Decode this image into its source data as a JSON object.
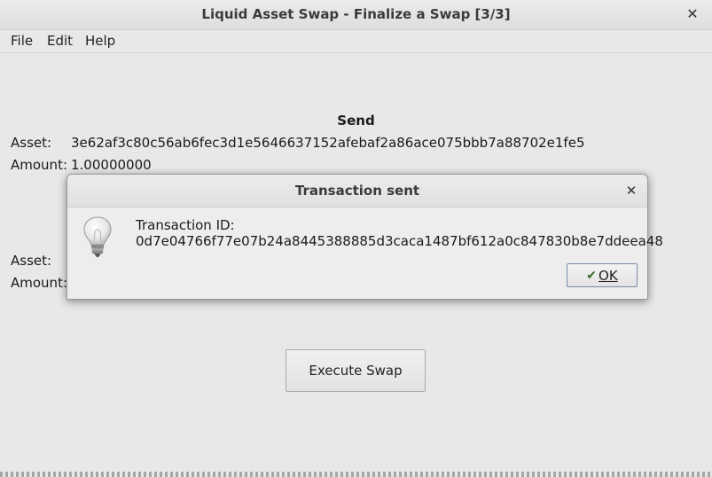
{
  "window": {
    "title": "Liquid Asset Swap - Finalize a Swap [3/3]",
    "close_glyph": "✕"
  },
  "menu": {
    "file": "File",
    "edit": "Edit",
    "help": "Help"
  },
  "send": {
    "heading": "Send",
    "asset_label": "Asset:",
    "asset_value": "3e62af3c80c56ab6fec3d1e5646637152afebaf2a86ace075bbb7a88702e1fe5",
    "amount_label": "Amount:",
    "amount_value": "1.00000000"
  },
  "receive": {
    "asset_label": "Asset:",
    "amount_label": "Amount:"
  },
  "execute_button": "Execute Swap",
  "dialog": {
    "title": "Transaction sent",
    "close_glyph": "✕",
    "icon": "lightbulb-icon",
    "line1": "Transaction ID:",
    "line2": "0d7e04766f77e07b24a8445388885d3caca1487bf612a0c847830b8e7ddeea48",
    "ok_check": "✔",
    "ok_label": "OK"
  }
}
